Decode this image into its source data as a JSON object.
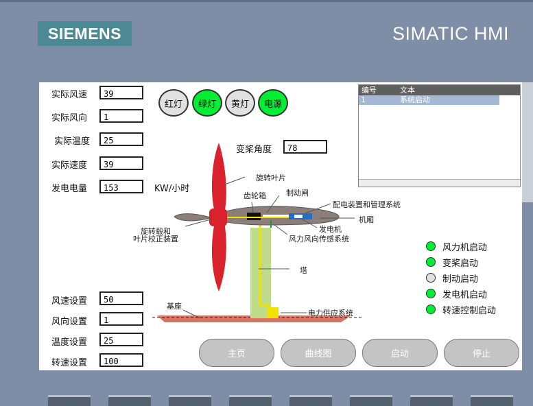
{
  "brand": "SIEMENS",
  "product": "SIMATIC HMI",
  "readings": [
    {
      "label": "实际风速",
      "value": "39"
    },
    {
      "label": "实际风向",
      "value": "1"
    },
    {
      "label": "实际温度",
      "value": "25"
    },
    {
      "label": "实际速度",
      "value": "39"
    },
    {
      "label": "发电电量",
      "value": "153"
    }
  ],
  "power_unit": "KW/小时",
  "lamps": [
    {
      "label": "红灯",
      "state": "off"
    },
    {
      "label": "绿灯",
      "state": "on"
    },
    {
      "label": "黄灯",
      "state": "off"
    },
    {
      "label": "电源",
      "state": "on"
    }
  ],
  "pitch": {
    "label": "变桨角度",
    "value": "78"
  },
  "diagram_labels": {
    "blade": "旋转叶片",
    "gearbox": "齿轮箱",
    "brake": "制动闸",
    "distribution": "配电装置和管理系统",
    "nacelle": "机厢",
    "generator": "发电机",
    "sensor": "风力风向传感系统",
    "hub": "旋转毂和\n叶片校正装置",
    "tower": "塔",
    "base": "基座",
    "power_supply": "电力供应系统"
  },
  "alarm": {
    "col_no": "编号",
    "col_text": "文本",
    "rows": [
      {
        "no": "1",
        "text": "系统启动"
      }
    ]
  },
  "status": [
    {
      "label": "风力机启动",
      "active": true
    },
    {
      "label": "变桨启动",
      "active": true
    },
    {
      "label": "制动启动",
      "active": false
    },
    {
      "label": "发电机启动",
      "active": true
    },
    {
      "label": "转速控制启动",
      "active": true
    }
  ],
  "settings": [
    {
      "label": "风速设置",
      "value": "50"
    },
    {
      "label": "风向设置",
      "value": "1"
    },
    {
      "label": "温度设置",
      "value": "25"
    },
    {
      "label": "转速设置",
      "value": "100"
    }
  ],
  "buttons": {
    "home": "主页",
    "curve": "曲线图",
    "start": "启动",
    "stop": "停止"
  },
  "colors": {
    "on": "#00ee33",
    "off": "#e1e1e1",
    "panel": "#7d8ea6",
    "brand": "#4b8a95"
  }
}
